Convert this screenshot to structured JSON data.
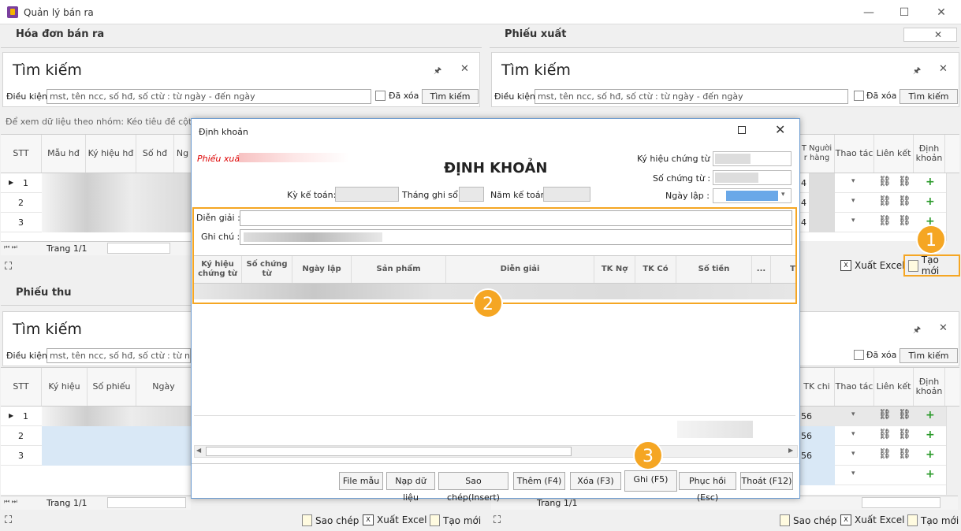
{
  "window": {
    "title": "Quản lý bán ra",
    "minimize": "—",
    "maximize": "☐",
    "close": "✕"
  },
  "sections": {
    "hoa_don": "Hóa đơn bán ra",
    "phieu_xuat": "Phiếu xuất",
    "phieu_thu": "Phiếu thu"
  },
  "search": {
    "title": "Tìm kiếm",
    "label": "Điều kiện:",
    "placeholder": "mst, tên ncc, số hđ, số ctừ : từ ngày - đến ngày",
    "deleted": "Đã xóa",
    "button": "Tìm kiếm",
    "pin": "🖈",
    "close": "✕"
  },
  "group_hint": "Để xem dữ liệu theo nhóm: Kéo tiêu đề cột muốn nhóm vào đây",
  "grid1": {
    "headers": [
      "STT",
      "Mẫu hđ",
      "Ký hiệu hđ",
      "Số hđ",
      "Ng"
    ],
    "rows": [
      "1",
      "2",
      "3"
    ],
    "pager": "Trang 1/1"
  },
  "grid2": {
    "headers": [
      "T Người r hàng",
      "Thao tác",
      "Liên kết",
      "Định khoản"
    ],
    "rows": [
      "4",
      "4",
      "4"
    ]
  },
  "grid3": {
    "headers": [
      "STT",
      "Ký hiệu",
      "Số phiếu",
      "Ngày"
    ],
    "rows": [
      "1",
      "2",
      "3"
    ],
    "pager": "Trang 1/1"
  },
  "grid4": {
    "headers": [
      "TK chi",
      "Thao tác",
      "Liên kết",
      "Định khoản"
    ],
    "rows": [
      "56",
      "56",
      "56"
    ],
    "pager": "Trang 1/1"
  },
  "toolbar": {
    "export_excel": "Xuất Excel",
    "create_new": "Tạo mới",
    "copy": "Sao chép"
  },
  "dialog": {
    "title": "Định khoản",
    "heading": "ĐỊNH KHOẢN",
    "source": "Phiếu xuất",
    "ky_hieu_label": "Ký hiệu chứng từ :",
    "so_chung_tu_label": "Số chứng từ :",
    "ngay_lap_label": "Ngày lập :",
    "ky_ke_toan_label": "Kỳ kế toán:",
    "thang_ghi_so_label": "Tháng ghi sổ :",
    "nam_ke_toan_label": "Năm kế toán :",
    "dien_giai_label": "Diễn giải :",
    "ghi_chu_label": "Ghi chú :",
    "columns": [
      "Ký hiệu chứng từ",
      "Số chứng từ",
      "Ngày lập",
      "Sản phẩm",
      "Diễn giải",
      "TK Nợ",
      "TK Có",
      "Số tiền",
      "...",
      "T"
    ],
    "buttons": [
      "File mẫu",
      "Nạp dữ liệu",
      "Sao chép(Insert)",
      "Thêm (F4)",
      "Xóa (F3)",
      "Ghi (F5)",
      "Phục hồi (Esc)",
      "Thoát (F12)"
    ]
  },
  "callouts": [
    "1",
    "2",
    "3"
  ],
  "colors": {
    "accent": "#f5a623",
    "plus": "#2a9a2a",
    "selected_row": "#d9e8f6"
  }
}
